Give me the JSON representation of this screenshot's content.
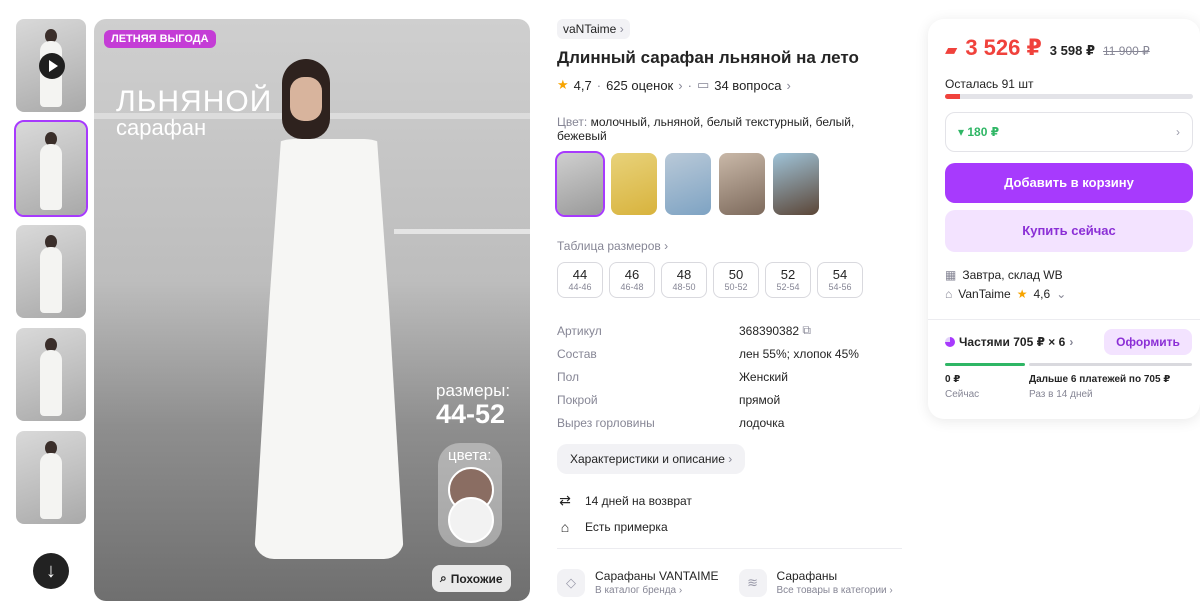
{
  "gallery": {
    "promo_badge": "ЛЕТНЯЯ ВЫГОДА",
    "overlay_title": "ЛЬНЯНОЙ",
    "overlay_subtitle": "сарафан",
    "sizes_label": "размеры:",
    "sizes_value": "44-52",
    "colors_label": "цвета:",
    "similar_button": "Похожие"
  },
  "product": {
    "brand": "vaNTaime",
    "title": "Длинный сарафан льняной на лето",
    "rating": "4,7",
    "reviews": "625 оценок",
    "questions": "34 вопроса",
    "color_label": "Цвет:",
    "colors": "молочный, льняной, белый текстурный, белый, бежевый",
    "size_table_link": "Таблица размеров",
    "sizes": [
      {
        "num": "44",
        "range": "44-46"
      },
      {
        "num": "46",
        "range": "46-48"
      },
      {
        "num": "48",
        "range": "48-50"
      },
      {
        "num": "50",
        "range": "50-52"
      },
      {
        "num": "52",
        "range": "52-54"
      },
      {
        "num": "54",
        "range": "54-56"
      }
    ],
    "specs": [
      {
        "k": "Артикул",
        "v": "368390382"
      },
      {
        "k": "Состав",
        "v": "лен 55%; хлопок 45%"
      },
      {
        "k": "Пол",
        "v": "Женский"
      },
      {
        "k": "Покрой",
        "v": "прямой"
      },
      {
        "k": "Вырез горловины",
        "v": "лодочка"
      }
    ],
    "desc_button": "Характеристики и описание",
    "return_policy": "14 дней на возврат",
    "fitting": "Есть примерка",
    "brand_catalog_title": "Сарафаны VANTAIME",
    "brand_catalog_sub": "В каталог бренда",
    "category_title": "Сарафаны",
    "category_sub": "Все товары в категории"
  },
  "buy": {
    "price": "3 526 ₽",
    "price_no_wallet": "3 598 ₽",
    "price_old": "11 900 ₽",
    "stock": "Осталась 91 шт",
    "stock_fill_pct": 6,
    "bonus": "180 ₽",
    "add_to_cart": "Добавить в корзину",
    "buy_now": "Купить сейчас",
    "delivery": "Завтра, склад WB",
    "seller": "VanTaime",
    "seller_rating": "4,6",
    "installments": "Частями 705 ₽ × 6",
    "order_button": "Оформить",
    "now_amount": "0 ₽",
    "now_label": "Сейчас",
    "later_amount": "Дальше 6 платежей по 705 ₽",
    "later_label": "Раз в 14 дней"
  },
  "colors": {
    "accent": "#a73afd",
    "price_red": "#f0423c",
    "bonus_green": "#2fb665"
  }
}
